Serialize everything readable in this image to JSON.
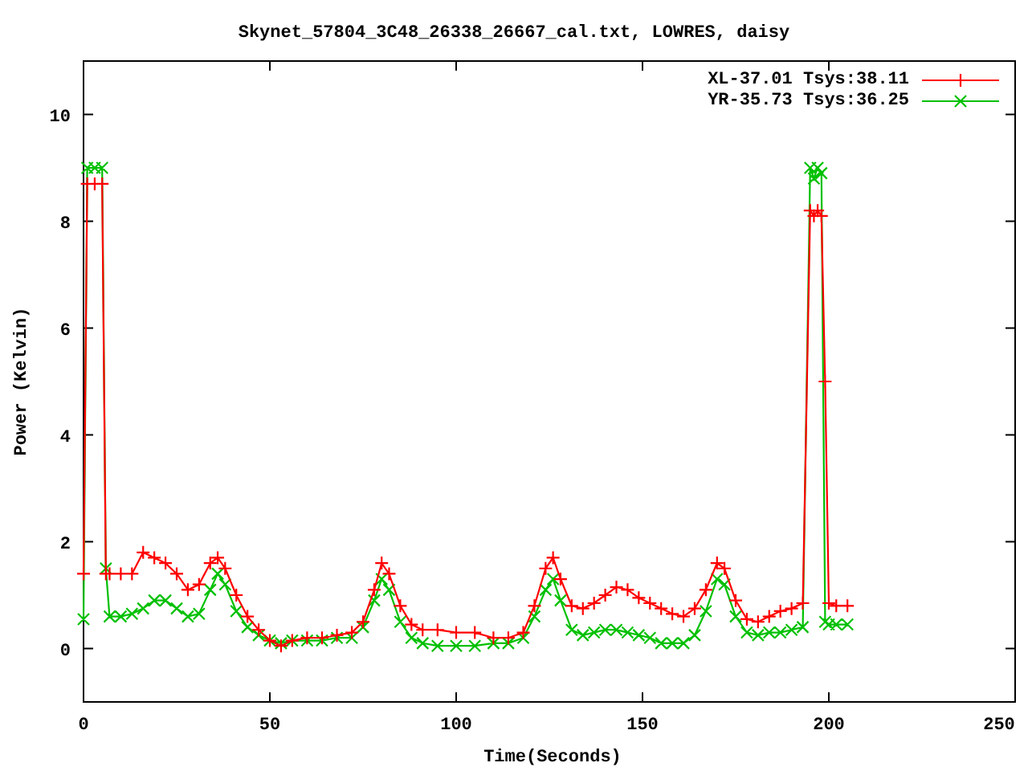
{
  "chart": {
    "chart_data": {
      "type": "line",
      "title": "Skynet_57804_3C48_26338_26667_cal.txt, LOWRES, daisy",
      "xlabel": "Time(Seconds)",
      "ylabel": "Power (Kelvin)",
      "x": [
        0,
        1,
        3,
        5,
        6,
        7,
        10,
        13,
        16,
        19,
        22,
        25,
        28,
        31,
        34,
        36,
        38,
        41,
        44,
        47,
        50,
        53,
        56,
        60,
        64,
        68,
        72,
        75,
        78,
        80,
        82,
        85,
        88,
        91,
        95,
        100,
        105,
        110,
        114,
        118,
        121,
        124,
        126,
        128,
        131,
        134,
        137,
        140,
        143,
        146,
        149,
        152,
        155,
        158,
        161,
        164,
        167,
        170,
        172,
        175,
        178,
        181,
        184,
        187,
        190,
        193,
        195,
        196,
        197,
        198,
        199,
        200,
        202,
        205
      ],
      "series": [
        {
          "name": "XL-37.01 Tsys:38.11",
          "color": "#ff0000",
          "marker": "plus",
          "values": [
            1.4,
            8.7,
            8.7,
            8.7,
            1.4,
            1.4,
            1.4,
            1.4,
            1.8,
            1.7,
            1.6,
            1.4,
            1.1,
            1.2,
            1.6,
            1.7,
            1.5,
            1.0,
            0.6,
            0.35,
            0.15,
            0.05,
            0.15,
            0.2,
            0.2,
            0.25,
            0.3,
            0.5,
            1.1,
            1.6,
            1.4,
            0.8,
            0.45,
            0.35,
            0.35,
            0.3,
            0.3,
            0.2,
            0.2,
            0.3,
            0.8,
            1.5,
            1.7,
            1.3,
            0.8,
            0.75,
            0.85,
            1.0,
            1.15,
            1.1,
            0.95,
            0.85,
            0.75,
            0.65,
            0.6,
            0.75,
            1.1,
            1.6,
            1.5,
            0.9,
            0.55,
            0.5,
            0.6,
            0.7,
            0.75,
            0.85,
            8.2,
            8.1,
            8.2,
            8.1,
            5.0,
            0.85,
            0.8,
            0.8
          ]
        },
        {
          "name": "YR-35.73 Tsys:36.25",
          "color": "#00c000",
          "marker": "cross",
          "values": [
            0.55,
            9.0,
            9.0,
            9.0,
            1.5,
            0.6,
            0.6,
            0.65,
            0.75,
            0.9,
            0.9,
            0.75,
            0.6,
            0.65,
            1.1,
            1.4,
            1.2,
            0.7,
            0.4,
            0.25,
            0.15,
            0.1,
            0.15,
            0.15,
            0.15,
            0.2,
            0.2,
            0.4,
            0.9,
            1.3,
            1.1,
            0.5,
            0.2,
            0.1,
            0.05,
            0.05,
            0.05,
            0.1,
            0.1,
            0.2,
            0.6,
            1.1,
            1.3,
            0.9,
            0.35,
            0.25,
            0.3,
            0.35,
            0.35,
            0.3,
            0.25,
            0.2,
            0.1,
            0.1,
            0.1,
            0.25,
            0.7,
            1.3,
            1.2,
            0.6,
            0.3,
            0.25,
            0.3,
            0.3,
            0.35,
            0.4,
            9.0,
            8.8,
            9.0,
            8.9,
            0.5,
            0.45,
            0.45,
            0.45
          ]
        }
      ],
      "xlim": [
        0,
        250
      ],
      "ylim": [
        -1,
        11
      ],
      "xticks": [
        0,
        50,
        100,
        150,
        200,
        250
      ],
      "yticks": [
        0,
        2,
        4,
        6,
        8,
        10
      ]
    }
  }
}
